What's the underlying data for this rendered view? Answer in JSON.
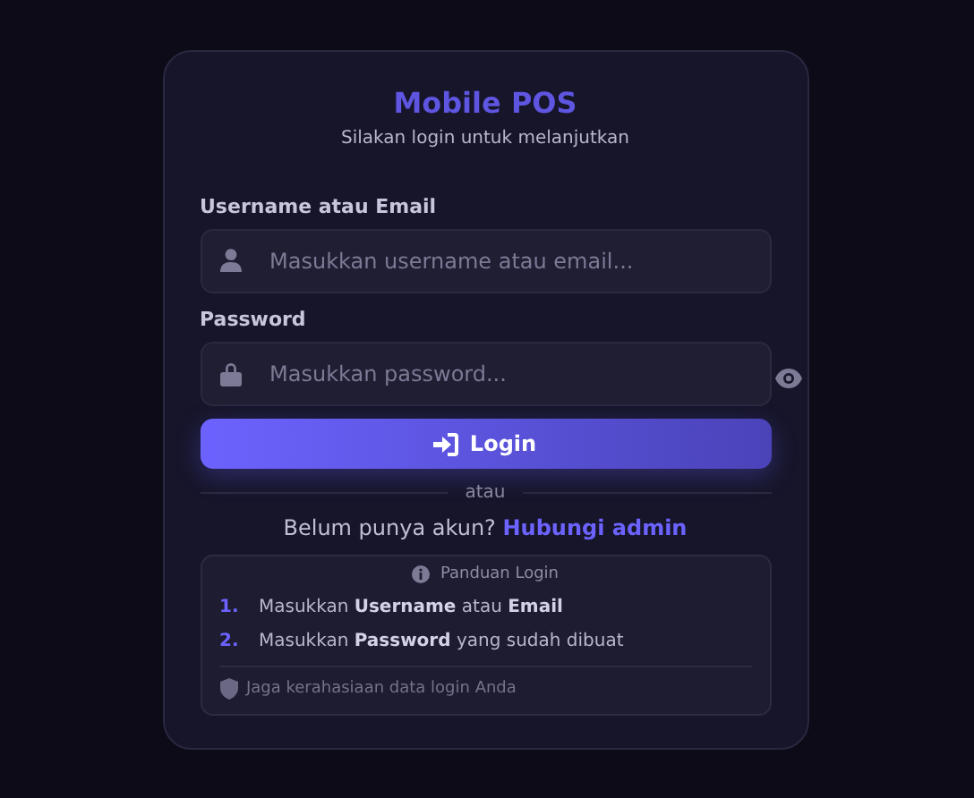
{
  "title": "Mobile POS",
  "subtitle": "Silakan login untuk melanjutkan",
  "fields": [
    {
      "kind": "user",
      "label": "Username atau Email",
      "placeholder": "Masukkan username atau email..."
    },
    {
      "kind": "password",
      "label": "Password",
      "placeholder": "Masukkan password..."
    }
  ],
  "login_button": "Login",
  "divider": "atau",
  "signup": {
    "text": "Belum punya akun?",
    "link": "Hubungi admin"
  },
  "guide": {
    "title": "Panduan Login",
    "steps": [
      {
        "number": "1.",
        "text": "Masukkan **Username** atau **Email**"
      },
      {
        "number": "2.",
        "text": "Masukkan **Password** yang sudah dibuat"
      }
    ],
    "note": "Jaga kerahasiaan data login Anda"
  }
}
